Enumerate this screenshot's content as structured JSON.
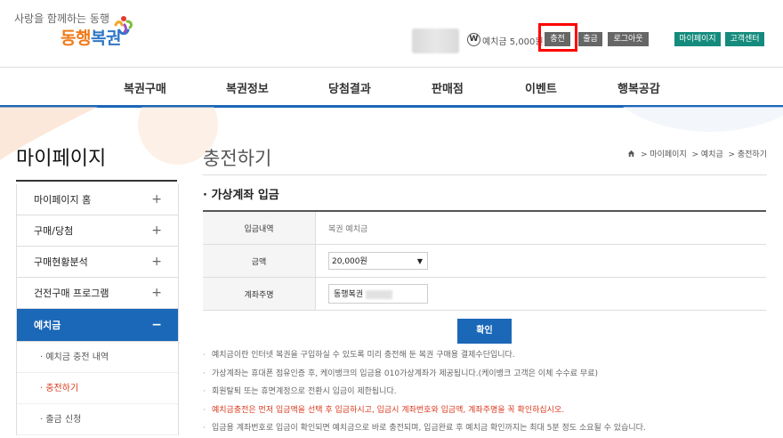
{
  "header": {
    "tagline": "사랑을 함께하는 동행",
    "logo_part1": "동행",
    "logo_part2": "복권",
    "won_symbol": "W",
    "balance": "예치금 5,000원",
    "buttons": {
      "charge": "충전",
      "withdraw": "출금",
      "logout": "로그아웃",
      "mypage": "마이페이지",
      "support": "고객센터"
    }
  },
  "nav": [
    "복권구매",
    "복권정보",
    "당첨결과",
    "판매점",
    "이벤트",
    "행복공감"
  ],
  "sidebar": {
    "title": "마이페이지",
    "items": [
      {
        "label": "마이페이지 홈",
        "toggle": "+"
      },
      {
        "label": "구매/당첨",
        "toggle": "+"
      },
      {
        "label": "구매현황분석",
        "toggle": "+"
      },
      {
        "label": "건전구매 프로그램",
        "toggle": "+"
      },
      {
        "label": "예치금",
        "toggle": "−"
      }
    ],
    "sub_items": [
      "예치금 충전 내역",
      "충전하기",
      "출금 신청"
    ]
  },
  "content": {
    "page_title": "충전하기",
    "breadcrumb": [
      "마이페이지",
      "예치금",
      "충전하기"
    ],
    "section_title": "가상계좌 입금",
    "rows": {
      "history_label": "입금내역",
      "history_value": "복권 예치금",
      "amount_label": "금액",
      "amount_value": "20,000원",
      "depositor_label": "계좌주명",
      "depositor_value": "동행복권"
    },
    "confirm": "확인",
    "notes": [
      "예치금이란 인터넷 복권을 구입하실 수 있도록 미리 충전해 둔 복권 구매용 결제수단입니다.",
      "가상계좌는 휴대폰 점유인증 후, 케이뱅크의 입금용 010가상계좌가 제공됩니다.(케이뱅크 고객은 이체 수수료 무료)",
      "회원탈퇴 또는 휴면계정으로 전환시 입금이 제한됩니다.",
      "예치금충전은 먼저 입금액을 선택 후 입금하시고, 입금시 계좌번호와 입금액, 계좌주명을 꼭 확인하십시오.",
      "입금용 계좌번호로 입금이 확인되면 예치금으로 바로 충전되며, 입금완료 후 예치금 확인까지는 최대 5분 정도 소요될 수 있습니다."
    ]
  },
  "colors": {
    "primary_blue": "#1b67b8",
    "teal": "#148b7c",
    "highlight_red": "#ff0000",
    "note_red": "#d9391d"
  }
}
